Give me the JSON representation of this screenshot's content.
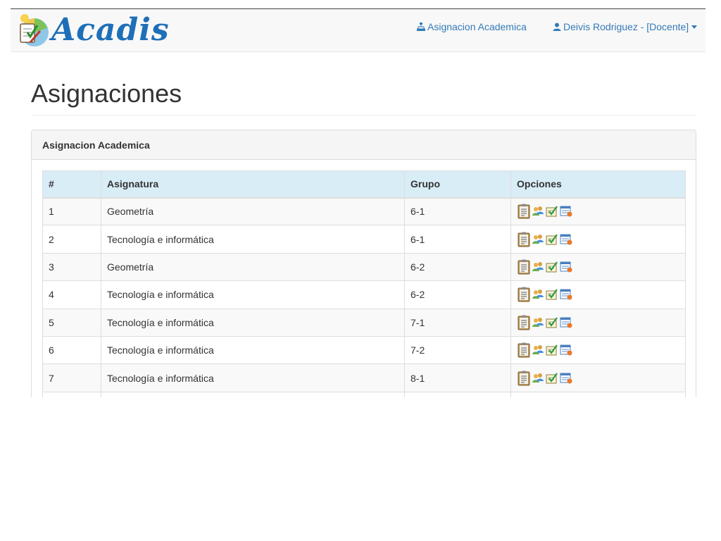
{
  "brand": {
    "name": "Acadis"
  },
  "nav": {
    "assignment_link": "Asignacion Academica",
    "user_menu": "Deivis Rodriguez - [Docente]"
  },
  "page": {
    "title": "Asignaciones"
  },
  "panel": {
    "heading": "Asignacion Academica"
  },
  "table": {
    "headers": [
      "#",
      "Asignatura",
      "Grupo",
      "Opciones"
    ],
    "rows": [
      {
        "num": "1",
        "subject": "Geometría",
        "group": "6-1"
      },
      {
        "num": "2",
        "subject": "Tecnología e informática",
        "group": "6-1"
      },
      {
        "num": "3",
        "subject": "Geometría",
        "group": "6-2"
      },
      {
        "num": "4",
        "subject": "Tecnología e informática",
        "group": "6-2"
      },
      {
        "num": "5",
        "subject": "Tecnología e informática",
        "group": "7-1"
      },
      {
        "num": "6",
        "subject": "Tecnología e informática",
        "group": "7-2"
      },
      {
        "num": "7",
        "subject": "Tecnología e informática",
        "group": "8-1"
      },
      {
        "num": "",
        "subject": "",
        "group": ""
      }
    ],
    "option_icons": [
      "clipboard-icon",
      "users-icon",
      "grade-check-icon",
      "report-icon"
    ]
  },
  "colors": {
    "link": "#337ab7",
    "header_row": "#d9edf7",
    "navbar": "#f8f8f8",
    "brand": "#1e6fb8"
  }
}
